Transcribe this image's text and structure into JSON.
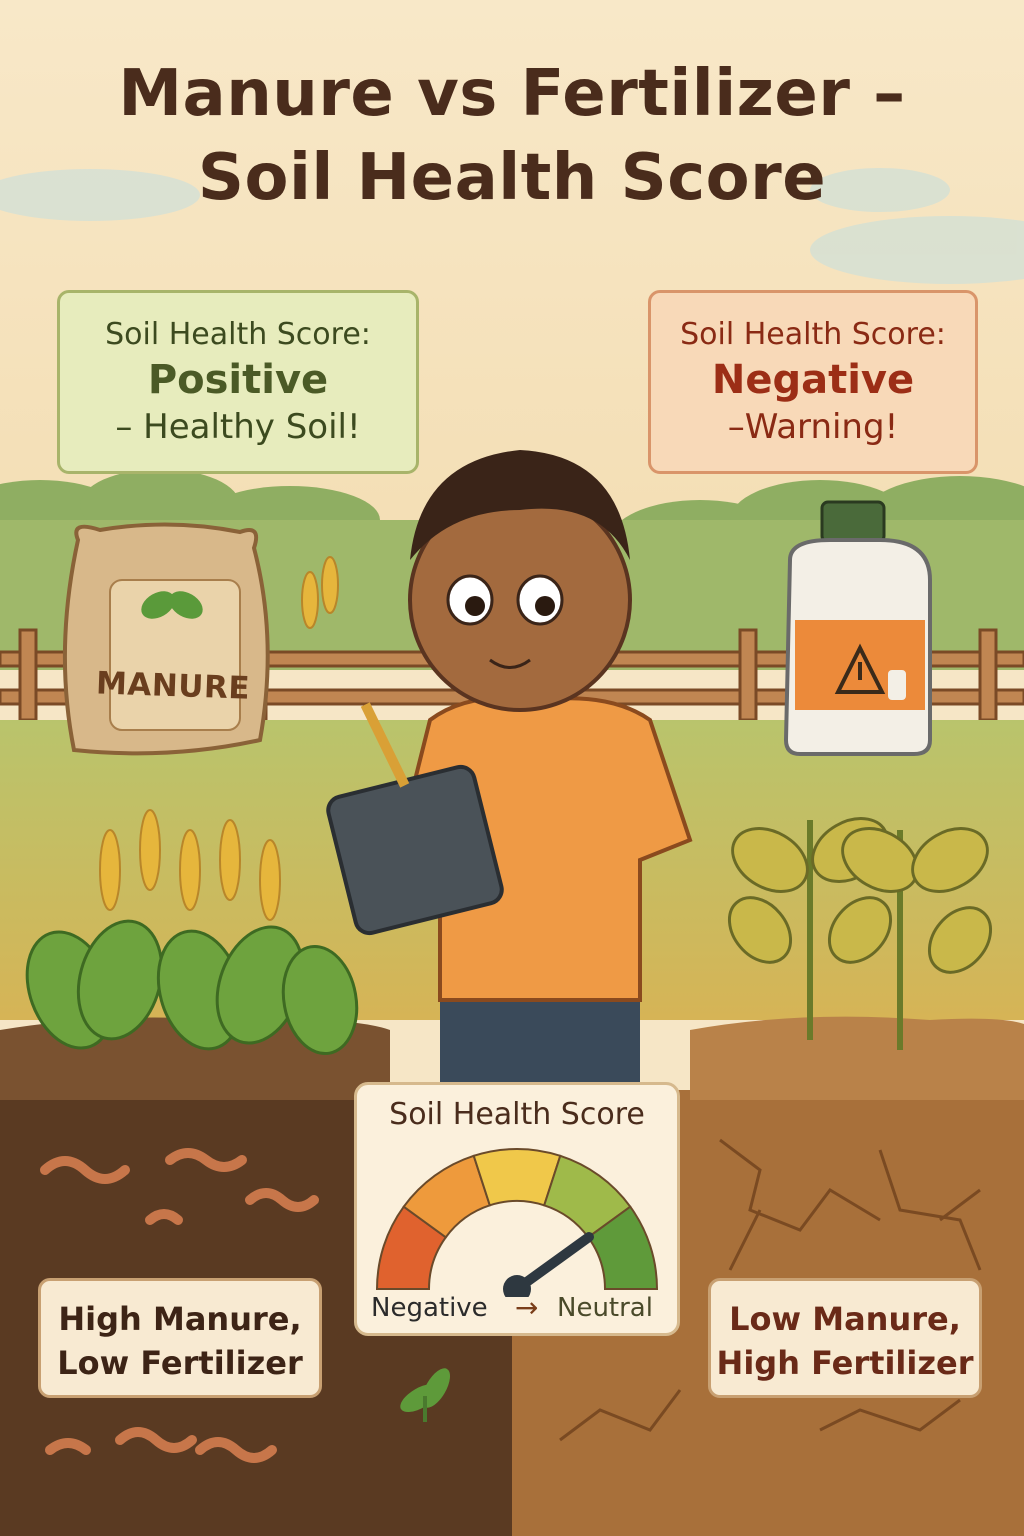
{
  "title": {
    "line1": "Manure vs Fertilizer –",
    "line2": "Soil Health Score"
  },
  "left_card": {
    "heading": "Soil Health Score:",
    "value": "Positive",
    "note": "– Healthy Soil!"
  },
  "right_card": {
    "heading": "Soil Health Score:",
    "value": "Negative",
    "note": "–Warning!"
  },
  "manure_bag": {
    "label": "MANURE",
    "icon": "leaf-icon"
  },
  "fertilizer_jug": {
    "icon": "warning-triangle-icon",
    "secondary_icon": "spray-bottle-icon"
  },
  "gauge": {
    "title": "Soil Health Score",
    "left_label": "Negative",
    "arrow": "→",
    "right_label": "Neutral",
    "segment_colors": [
      "#e0622e",
      "#ee9a3c",
      "#f0c84a",
      "#9fba4a",
      "#5f9a3a"
    ]
  },
  "left_label_box": {
    "line1": "High Manure,",
    "line2": "Low Fertilizer"
  },
  "right_label_box": {
    "line1": "Low Manure,",
    "line2": "High Fertilizer"
  },
  "colors": {
    "title": "#4a2c1c",
    "positive_bg": "#e7ecbd",
    "negative_bg": "#f8d9b8",
    "healthy_soil": "#5a3a22",
    "dry_soil": "#a8703a",
    "shirt": "#ef9a45"
  }
}
